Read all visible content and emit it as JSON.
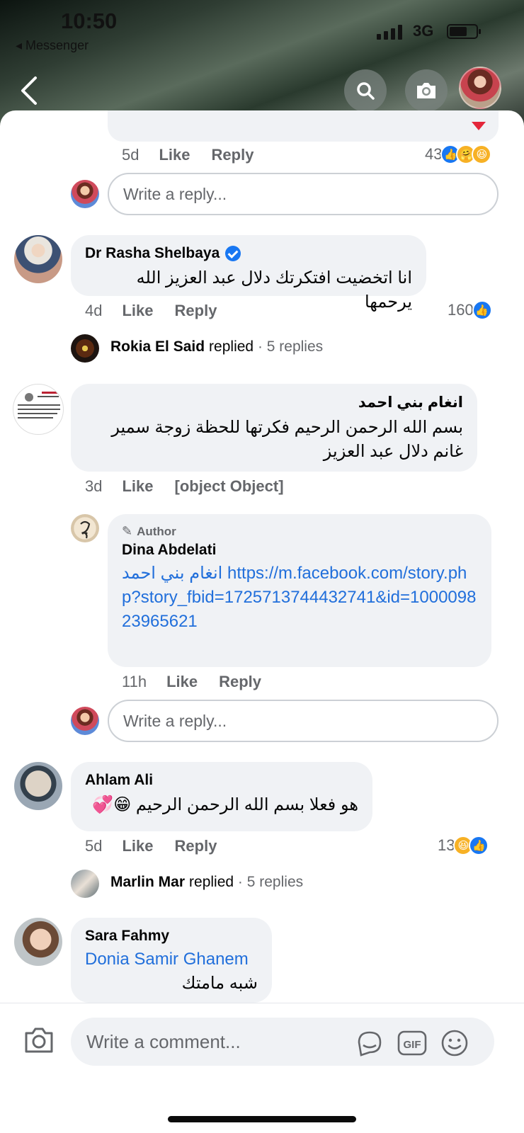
{
  "status_bar": {
    "time": "10:50",
    "back_app": "◂ Messenger",
    "network": "3G"
  },
  "header": {
    "back_icon": "chevron-left-icon",
    "search_icon": "search-icon",
    "camera_icon": "camera-icon"
  },
  "top_comment": {
    "time": "5d",
    "like": "Like",
    "reply": "Reply",
    "reaction_count": "43"
  },
  "reply_input": {
    "placeholder": "Write a reply..."
  },
  "comments": [
    {
      "name": "Dr Rasha Shelbaya",
      "verified": true,
      "text": "انا اتخضيت افتكرتك دلال عبد العزيز الله يرحمها",
      "time": "4d",
      "like": "Like",
      "reply": "Reply",
      "reaction_count": "160",
      "replies_summary": {
        "name": "Rokia El Said",
        "verb": "replied",
        "count": "· 5 replies"
      }
    },
    {
      "name": "انغام بني احمد",
      "text": "بسم الله الرحمن الرحيم فكرتها للحظة زوجة سمير غانم دلال عبد العزيز",
      "time": "3d",
      "like": "Like",
      "reply": {
        "badge": "Author",
        "name": "Dina Abdelati",
        "mention": "انغام بني احمد",
        "link": "https://m.facebook.com/story.php?story_fbid=1725713744432741&id=100009823965621",
        "time": "11h",
        "like": "Like",
        "reply": "Reply"
      }
    },
    {
      "name": "Ahlam Ali",
      "text": "هو فعلا بسم الله الرحمن الرحيم 😁💞",
      "time": "5d",
      "like": "Like",
      "reply": "Reply",
      "reaction_count": "13",
      "replies_summary": {
        "name": "Marlin Mar",
        "verb": "replied",
        "count": "· 5 replies"
      }
    },
    {
      "name": "Sara Fahmy",
      "mention": "Donia Samir Ghanem",
      "text": "شبه مامتك"
    }
  ],
  "composer": {
    "placeholder": "Write a comment...",
    "gif_label": "GIF"
  },
  "colors": {
    "accent": "#1877f2",
    "link": "#216fdb",
    "bubble": "#f0f2f5",
    "meta": "#65676b"
  }
}
